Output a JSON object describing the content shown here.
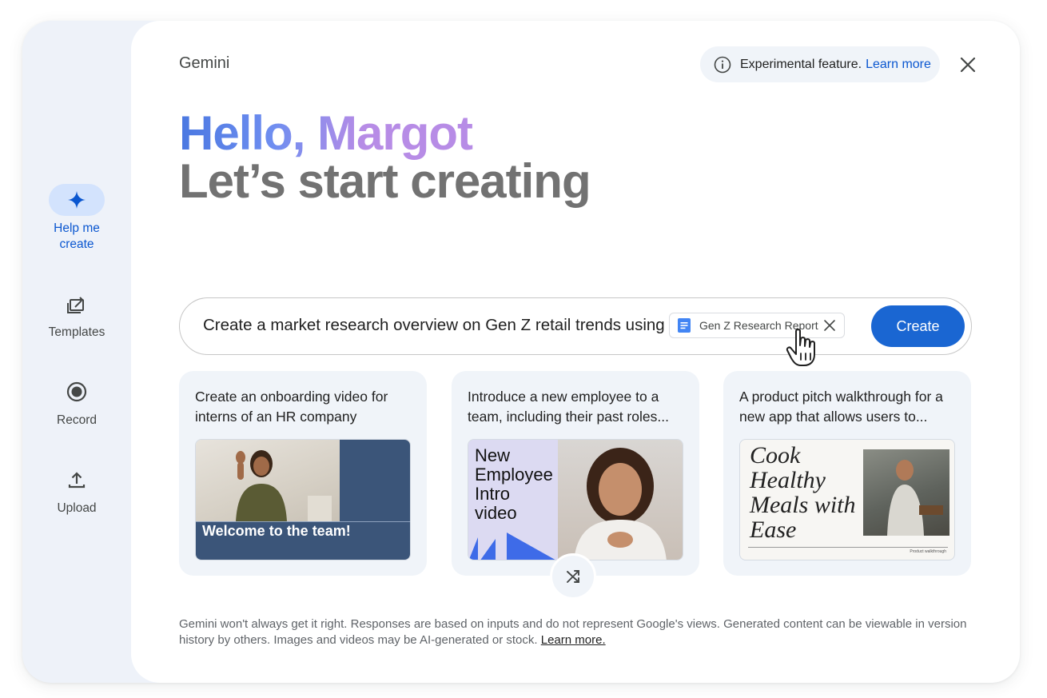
{
  "app": {
    "name": "Gemini"
  },
  "sidebar": {
    "items": [
      {
        "label": "Help me create",
        "icon": "sparkle-icon",
        "active": true
      },
      {
        "label": "Templates",
        "icon": "templates-icon",
        "active": false
      },
      {
        "label": "Record",
        "icon": "record-icon",
        "active": false
      },
      {
        "label": "Upload",
        "icon": "upload-icon",
        "active": false
      }
    ]
  },
  "header": {
    "notice": "Experimental feature.",
    "learn_more": "Learn more"
  },
  "greeting": {
    "hello": "Hello, Margot",
    "subtitle": "Let’s start creating"
  },
  "prompt": {
    "text": "Create a market research overview on Gen Z retail trends using",
    "attachment": "Gen Z Research Report",
    "create_label": "Create"
  },
  "suggestions": [
    {
      "text": "Create an onboarding video for interns of an HR company",
      "thumb_title": "Welcome to the team!"
    },
    {
      "text": "Introduce a new employee to a team, including their past roles...",
      "thumb_lines": [
        "New",
        "Employee",
        "Intro",
        "video"
      ]
    },
    {
      "text": "A product pitch walkthrough for a new app that allows users to...",
      "thumb_lines": [
        "Cook",
        "Healthy",
        "Meals with",
        "Ease"
      ],
      "thumb_caption": "Product walkthrough"
    }
  ],
  "disclaimer": {
    "text": "Gemini won't always get it right. Responses are based on inputs and do not represent Google's views. Generated content can be viewable in version history by others. Images and videos may be AI-generated or stock.",
    "link": "Learn more."
  },
  "colors": {
    "accent": "#0b57d0",
    "create_button": "#1a66d2",
    "rail_bg": "#eef2f9",
    "card_bg": "#f0f4f9"
  }
}
